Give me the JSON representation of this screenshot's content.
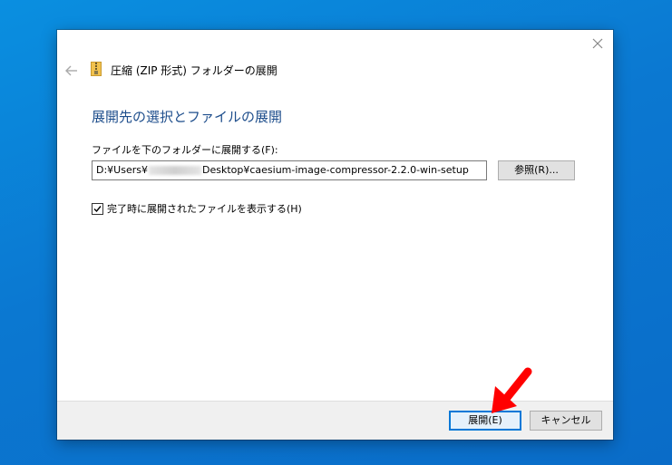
{
  "window": {
    "title": "圧縮 (ZIP 形式) フォルダーの展開",
    "close_icon": "close-icon",
    "back_icon": "back-arrow-icon",
    "zip_icon": "zip-folder-icon"
  },
  "main": {
    "heading": "展開先の選択とファイルの展開",
    "destination_label": "ファイルを下のフォルダーに展開する(F):",
    "destination_path_prefix": "D:¥Users¥",
    "destination_path_suffix": "Desktop¥caesium-image-compressor-2.2.0-win-setup",
    "browse_label": "参照(R)...",
    "show_files_label": "完了時に展開されたファイルを表示する(H)",
    "show_files_checked": true
  },
  "footer": {
    "extract_label": "展開(E)",
    "cancel_label": "キャンセル"
  },
  "annotation": {
    "arrow_icon": "red-arrow-icon",
    "arrow_color": "#ff0000"
  },
  "colors": {
    "desktop": "#0b78d1",
    "heading": "#1e4e8c",
    "accent": "#0078d7"
  }
}
